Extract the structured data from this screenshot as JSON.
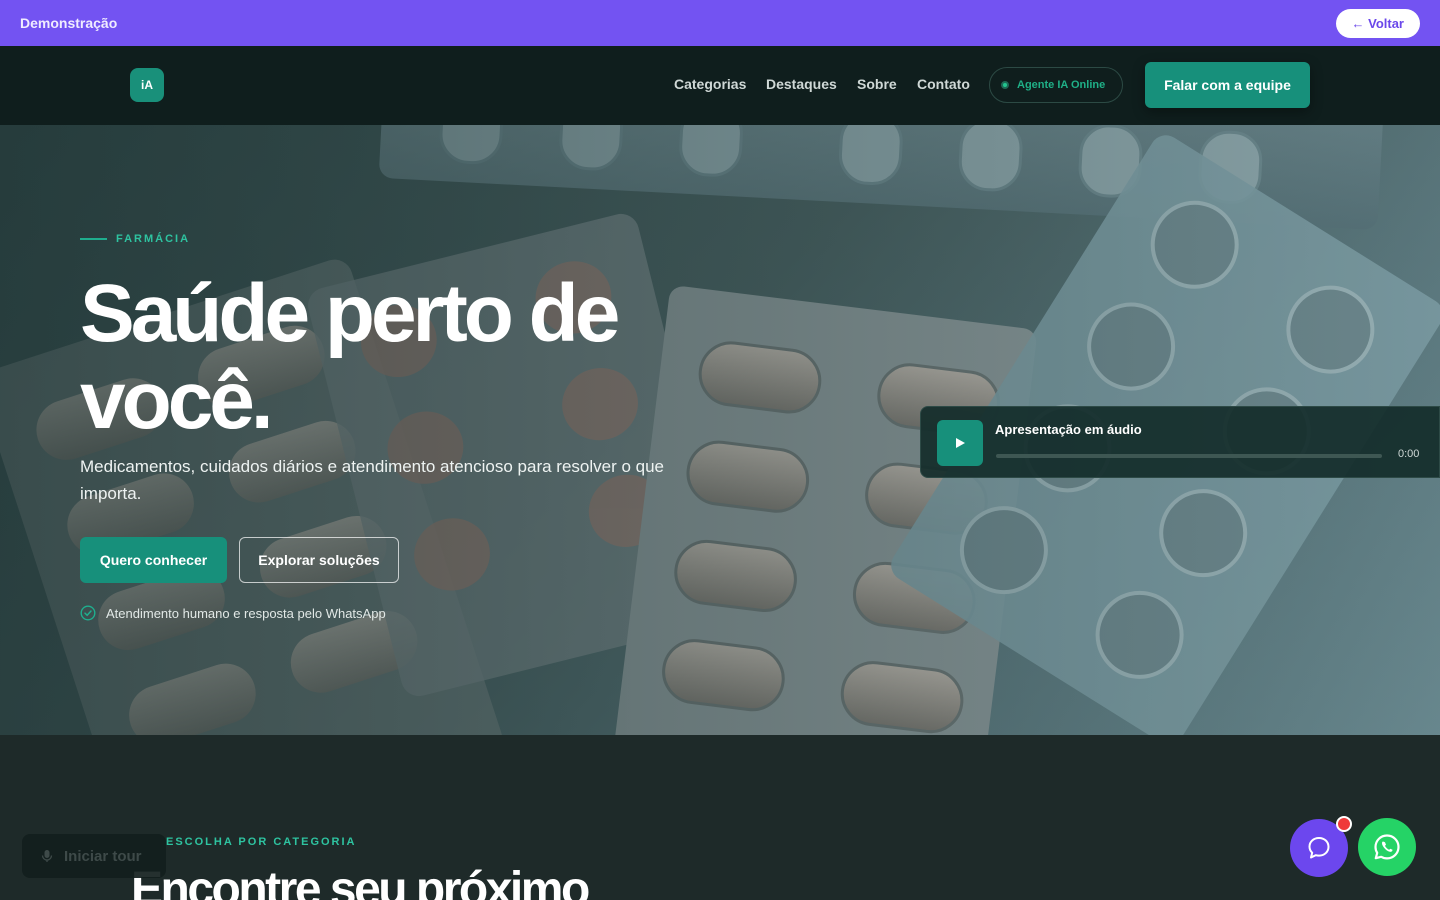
{
  "demo_bar": {
    "label": "Demonstração",
    "back_label": "← Voltar"
  },
  "nav": {
    "logo_text": "iA",
    "links": [
      "Categorias",
      "Destaques",
      "Sobre",
      "Contato"
    ],
    "agent_status": "Agente IA Online",
    "cta_label": "Falar com a equipe"
  },
  "hero": {
    "eyebrow": "FARMÁCIA",
    "title": "Saúde perto de você.",
    "subtitle": "Medicamentos, cuidados diários e atendimento atencioso para resolver o que importa.",
    "primary_cta": "Quero conhecer",
    "secondary_cta": "Explorar soluções",
    "trust_note": "Atendimento humano e resposta pelo WhatsApp"
  },
  "audio_player": {
    "title": "Apresentação em áudio",
    "time": "0:00",
    "progress": 0
  },
  "categories": {
    "eyebrow": "ESCOLHA POR CATEGORIA",
    "title": "Encontre seu próximo"
  },
  "floating": {
    "tour_label": "Iniciar tour"
  },
  "icons": {
    "play": "play-icon",
    "check": "check-circle-icon",
    "mic": "microphone-icon",
    "chat": "chat-bubble-icon",
    "whatsapp": "whatsapp-icon"
  },
  "colors": {
    "brand_purple": "#7353f2",
    "brand_green": "#17907b",
    "nav_bg": "#0f1e1d",
    "whatsapp": "#25d366",
    "badge_red": "#ef3a3a"
  }
}
